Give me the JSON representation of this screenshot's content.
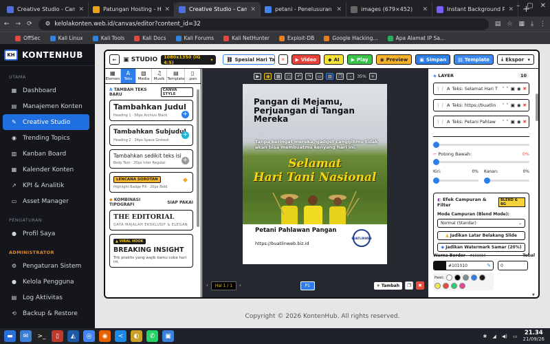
{
  "browser": {
    "tabs": [
      {
        "title": "Creative Studio - Can",
        "color": "#4f6ee0",
        "icon": "kontenhub-icon",
        "active": false
      },
      {
        "title": "Patungan Hosting - H",
        "color": "#e9a21a",
        "icon": "patungan-icon",
        "active": false
      },
      {
        "title": "Creative Studio - Can",
        "color": "#4f6ee0",
        "icon": "kontenhub-icon",
        "active": true
      },
      {
        "title": "petani - Penelusuran",
        "color": "#4285f4",
        "icon": "google-icon",
        "active": false
      },
      {
        "title": "images (679×452)",
        "color": "#666",
        "icon": "image-icon",
        "active": false
      },
      {
        "title": "Instant Background R",
        "color": "#7b5cff",
        "icon": "remove-bg-icon",
        "active": false
      }
    ],
    "url": "kelolakonten.web.id/canvas/editor?content_id=32",
    "bookmarks": [
      {
        "label": "OffSec",
        "color": "#e04a3f"
      },
      {
        "label": "Kali Linux",
        "color": "#2e86de"
      },
      {
        "label": "Kali Tools",
        "color": "#2e86de"
      },
      {
        "label": "Kali Docs",
        "color": "#e04a3f"
      },
      {
        "label": "Kali Forums",
        "color": "#2e86de"
      },
      {
        "label": "Kali NetHunter",
        "color": "#e04a3f"
      },
      {
        "label": "Exploit-DB",
        "color": "#e67e22"
      },
      {
        "label": "Google Hacking...",
        "color": "#e67e22"
      },
      {
        "label": "Apa Alamat IP Sa...",
        "color": "#27ae60"
      }
    ]
  },
  "sidebar": {
    "brand": "KONTENHUB",
    "logo_text": "KH",
    "sections": [
      {
        "title": "UTAMA",
        "admin": false,
        "items": [
          {
            "label": "Dashboard",
            "icon": "dashboard-icon",
            "glyph": "▦",
            "active": false
          },
          {
            "label": "Manajemen Konten",
            "icon": "document-icon",
            "glyph": "▤",
            "active": false
          },
          {
            "label": "Creative Studio",
            "icon": "brush-icon",
            "glyph": "✎",
            "active": true
          },
          {
            "label": "Trending Topics",
            "icon": "fire-icon",
            "glyph": "◉",
            "active": false
          },
          {
            "label": "Kanban Board",
            "icon": "kanban-icon",
            "glyph": "▥",
            "active": false
          },
          {
            "label": "Kalender Konten",
            "icon": "calendar-icon",
            "glyph": "▦",
            "active": false
          },
          {
            "label": "KPI & Analitik",
            "icon": "chart-icon",
            "glyph": "↗",
            "active": false
          },
          {
            "label": "Asset Manager",
            "icon": "folder-icon",
            "glyph": "▭",
            "active": false
          }
        ]
      },
      {
        "title": "PENGATURAN",
        "admin": false,
        "items": [
          {
            "label": "Profil Saya",
            "icon": "user-icon",
            "glyph": "●",
            "active": false
          }
        ]
      },
      {
        "title": "ADMINISTRATOR",
        "admin": true,
        "items": [
          {
            "label": "Pengaturan Sistem",
            "icon": "gear-icon",
            "glyph": "⚙",
            "active": false
          },
          {
            "label": "Kelola Pengguna",
            "icon": "users-icon",
            "glyph": "●",
            "active": false
          },
          {
            "label": "Log Aktivitas",
            "icon": "log-icon",
            "glyph": "▤",
            "active": false
          },
          {
            "label": "Backup & Restore",
            "icon": "backup-icon",
            "glyph": "⟲",
            "active": false
          }
        ]
      }
    ]
  },
  "toolbar": {
    "studio_label": "STUDIO",
    "size_label": "1080x1350 (IG 4:5)",
    "template_select": "Spesial Hari Tan...",
    "video_label": "Video",
    "ai_label": "AI",
    "play_label": "Play",
    "preview_label": "Preview",
    "save_label": "Simpan",
    "template_label": "Template",
    "export_label": "Ekspor"
  },
  "tools": [
    {
      "label": "Elemen",
      "glyph": "▦",
      "icon": "elements-icon",
      "active": false
    },
    {
      "label": "Teks",
      "glyph": "A",
      "icon": "text-icon",
      "active": true
    },
    {
      "label": "Media",
      "glyph": "▧",
      "icon": "media-icon",
      "active": false
    },
    {
      "label": "Musik",
      "glyph": "♫",
      "icon": "music-icon",
      "active": false
    },
    {
      "label": "Template",
      "glyph": "▤",
      "icon": "template-icon",
      "active": false
    },
    {
      "label": ".pen",
      "glyph": "▯",
      "icon": "pen-file-icon",
      "active": false
    }
  ],
  "left_panel": {
    "add_text_header": "TAMBAH TEKS BARU",
    "canva_style": "CANVA STYLE",
    "heading1": {
      "title": "Tambahkan Judul",
      "sub": "Heading 1 · 56px Archivo Black",
      "plus_color": "#2d7ee8"
    },
    "heading2": {
      "title": "Tambahkan Subjudul",
      "sub": "Heading 2 · 34px Space Grotesk",
      "plus_color": "#1eb6d6"
    },
    "body": {
      "title": "Tambahkan sedikit teks isi",
      "sub": "Body Text · 20px Inter Regular",
      "plus_color": "#999"
    },
    "highlight": {
      "title": "LENCANA SOROTAN",
      "sub": "Highlight Badge Fill · 20px Bold"
    },
    "combo_header": "KOMBINASI TIPOGRAFI",
    "combo_badge": "SIAP PAKAI",
    "editorial": {
      "title": "THE EDITORIAL",
      "sub": "GAYA MAJALAH EKSKLUSIF & ELEGAN"
    },
    "viral": {
      "badge": "VIRAL HOOK",
      "title": "BREAKING INSIGHT",
      "sub": "Trik praktis yang wajib kamu coba hari ini."
    }
  },
  "canvas": {
    "zoom": "35%",
    "page_label": "Hal 1 / 1",
    "page_btn": "P1",
    "add_label": "Tambah",
    "poster": {
      "title": "Pangan di Mejamu, Perjuangan di Tangan Mereka",
      "subtitle": "Tanpa keringat mereka, gadget canggihmu tidak akan bisa membuatmu kenyang hari ini.",
      "greeting1": "Selamat",
      "greeting2": "Hari Tani Nasional",
      "name": "Petani Pahlawan Pangan",
      "url": "https://buatlinweb.biz.id",
      "badge": "BUATLINWEB"
    }
  },
  "right_panel": {
    "layer_title": "LAYER",
    "layer_count": "10",
    "layers": [
      "Teks: Selamat Hari T",
      "Teks: https://buatlin",
      "Teks: Petani Pahlaw"
    ],
    "crop_bottom": "Potong Bawah:",
    "crop_bottom_val": "0%",
    "left_label": "Kiri:",
    "left_val": "0%",
    "right_label": "Kanan:",
    "right_val": "0%",
    "blend_title": "Efek Campuran & Filter",
    "blend_badge": "BLEND & BG",
    "blend_mode_label": "Mode Campuran (Blend Mode):",
    "blend_mode_value": "Normal (Standar)",
    "btn_bg": "Jadikan Latar Belakang Slide",
    "btn_watermark": "Jadikan Watermark Samar (20%)",
    "border_color_label": "Warna Border",
    "border_color_value": "#101010",
    "border_color_swatch": "#101010",
    "thick_label": "Tebal",
    "thick_value": "0",
    "palette_label": "Palet:",
    "palette": [
      "#ffffff",
      "#000000",
      "#7f8c8d",
      "#2d7ee8",
      "#1a1a1a",
      "#f1e94c",
      "#e74c3c",
      "#2ecc71",
      "#e84393"
    ]
  },
  "footer": {
    "text": "Copyright © 2026 KontenHub. All rights reserved."
  },
  "taskbar": {
    "time": "21.34",
    "date": "21/09/26",
    "apps": [
      {
        "icon": "desktop-icon",
        "color": "#2d6fd8",
        "glyph": "▬"
      },
      {
        "icon": "mail-icon",
        "color": "#3a80d9",
        "glyph": "✉"
      },
      {
        "icon": "terminal-icon",
        "color": "#222",
        "glyph": ">_"
      },
      {
        "icon": "pdf-icon",
        "color": "#c0392b",
        "glyph": "▯"
      },
      {
        "icon": "kali-icon",
        "color": "#1c5aa8",
        "glyph": "◭"
      },
      {
        "icon": "chrome-icon",
        "color": "#4285f4",
        "glyph": "◎"
      },
      {
        "icon": "firefox-icon",
        "color": "#e66000",
        "glyph": "◉"
      },
      {
        "icon": "vscode-icon",
        "color": "#1e88e5",
        "glyph": "≺"
      },
      {
        "icon": "app-icon",
        "color": "#c9a227",
        "glyph": "◐"
      },
      {
        "icon": "whatsapp-icon",
        "color": "#25d366",
        "glyph": "✆"
      },
      {
        "icon": "editor-icon",
        "color": "#3a80d9",
        "glyph": "▣"
      }
    ]
  }
}
